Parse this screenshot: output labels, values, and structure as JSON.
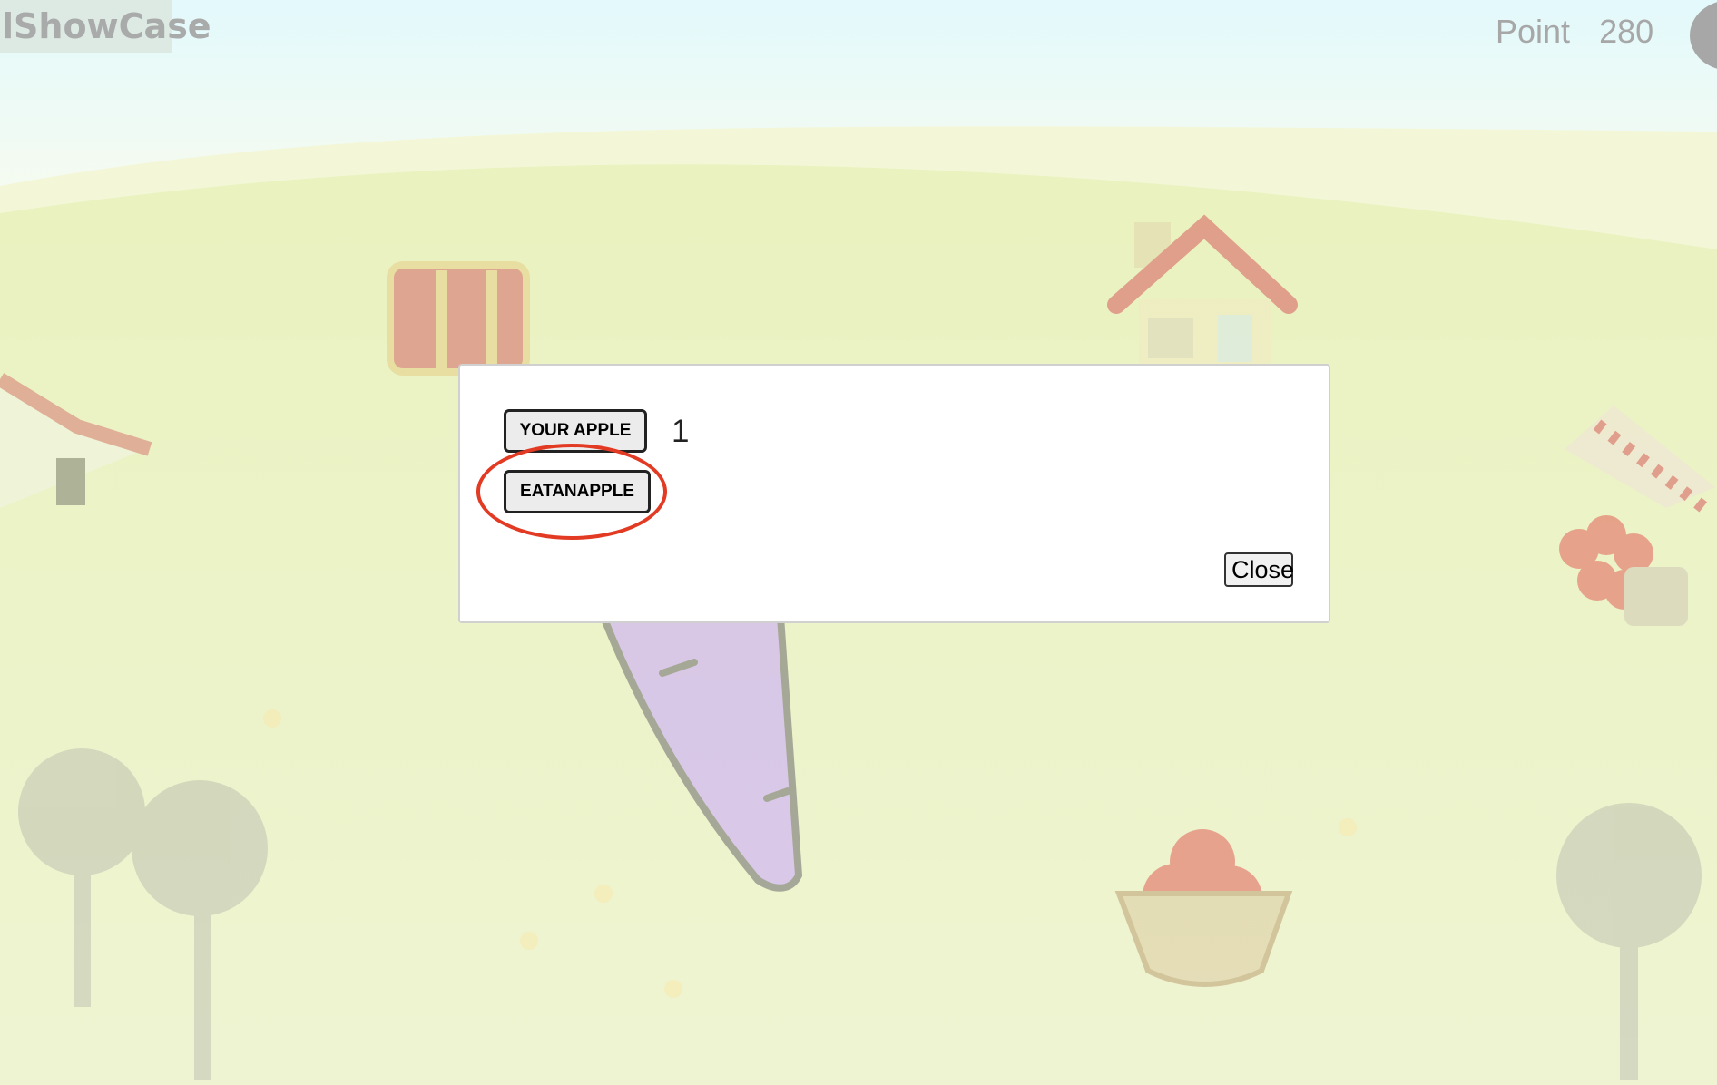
{
  "header": {
    "brand_text": "lShowCase",
    "points_label": "Point",
    "points_value": "280"
  },
  "dialog": {
    "your_apple_label": "YOUR APPLE",
    "apple_count": "1",
    "eat_apple_label": "EATANAPPLE",
    "close_label": "Close"
  },
  "icons": [
    "treasure-chest-icon",
    "house-icon",
    "barn-icon",
    "fruit-stand-icon",
    "carrot-icon",
    "apple-basket-icon",
    "tree-icon",
    "flower-icon"
  ],
  "colors": {
    "highlight": "#e23a23",
    "sky": "#dff7fb",
    "field": "#eef4cd"
  }
}
